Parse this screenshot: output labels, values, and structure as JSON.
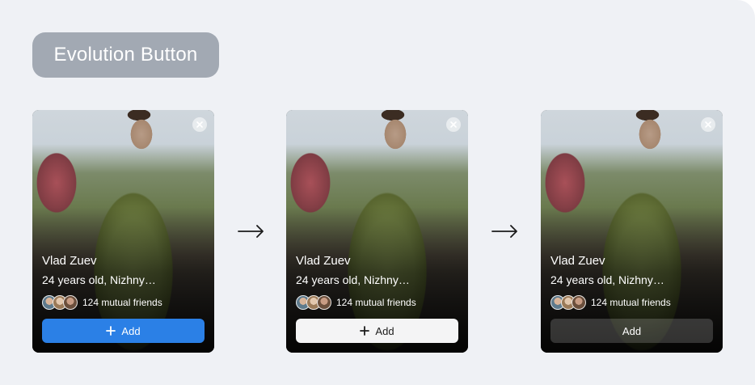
{
  "title": "Evolution Button",
  "card": {
    "name": "Vlad Zuev",
    "info": "24 years old, Nizhny…",
    "mutual": "124 mutual friends",
    "add_label": "Add"
  },
  "icons": {
    "close": "close-icon",
    "plus": "plus-icon",
    "arrow": "arrow-right-icon"
  },
  "colors": {
    "background": "#eff1f5",
    "title_chip": "#a2a9b3",
    "button_blue": "#2b80e6",
    "button_white": "#f4f4f5",
    "button_dark": "rgba(255,255,255,0.18)"
  }
}
